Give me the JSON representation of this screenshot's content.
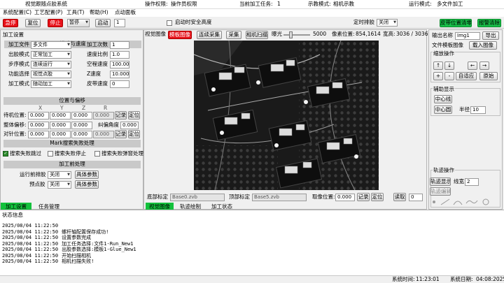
{
  "title": "视觉跟随点胶系统",
  "header_info": [
    {
      "label": "操作权限:",
      "value": "操作员权限"
    },
    {
      "label": "当前加工任务:",
      "value": "1"
    },
    {
      "label": "示教模式:",
      "value": "相机示教"
    },
    {
      "label": "运行模式:",
      "value": "多文件加工"
    }
  ],
  "menu": [
    "系统配置(C)",
    "工艺配置(P)",
    "工具(T)",
    "帮助(H)",
    "点动面板"
  ],
  "toolbar": {
    "emergency": "急停",
    "reset": "复位",
    "stop": "停止",
    "pause": "暂停",
    "start": "启动",
    "count": "1",
    "safe_height": "启动时安全高度",
    "timed_clear": "定时排胶",
    "timed_clear_value": "关闭",
    "back_to_pickup": "皮带位置清零",
    "alarm_clear": "报警清除"
  },
  "left": {
    "title": "加工设置",
    "mode_section": "模式与速度",
    "rows": [
      {
        "l1": "加工文件",
        "v1": "多文件",
        "l2": "加工次数",
        "v2": "1"
      },
      {
        "l1": "出胶模式",
        "v1": "正常加工",
        "l2": "速度比例",
        "v2": "1.0"
      },
      {
        "l1": "步序模式",
        "v1": "连续运行",
        "l2": "空程速度",
        "v2": "100.000"
      },
      {
        "l1": "功能选择",
        "v1": "视觉点胶",
        "l2": "Z速度",
        "v2": "10.000"
      },
      {
        "l1": "加工模式",
        "v1": "随动加工",
        "l2": "皮带速度",
        "v2": "0"
      }
    ],
    "pos_section": "位置与偏移",
    "axes": [
      "X",
      "Y",
      "Z",
      "R"
    ],
    "pos_rows": [
      {
        "label": "待机位置:",
        "vals": [
          "0.000",
          "0.000",
          "0.000",
          "0.000"
        ],
        "b1": "记录",
        "b2": "定位"
      },
      {
        "label": "整体偏移:",
        "vals": [
          "0.000",
          "0.000",
          "0.000"
        ],
        "extra_label": "纠偏角度",
        "extra_val": "0.000"
      },
      {
        "label": "对针位置:",
        "vals": [
          "0.000",
          "0.000",
          "0.000",
          "0.000"
        ],
        "b1": "记录",
        "b2": "定位"
      }
    ],
    "mark_section": "Mark搜索失败处理",
    "mark_opts": [
      "搜索失败跳过",
      "搜索失败停止",
      "搜索失败弹窗处理"
    ],
    "pre_section": "加工前处理",
    "pre_rows": [
      {
        "label": "运行前排胶",
        "value": "关闭",
        "btn": "具体参数"
      },
      {
        "label": "预点胶",
        "value": "关闭",
        "btn": "具体参数"
      }
    ],
    "tabs": [
      "加工设置",
      "任务管理"
    ]
  },
  "vision": {
    "tab_label": "视觉图像",
    "template_btn": "模板图像",
    "continuous": "连续采集",
    "capture": "采集",
    "scan": "相机扫描",
    "exposure_label": "曝光",
    "exposure": "5000",
    "pixel_label": "像素位置:",
    "pixel": "854,1614",
    "width_label": "宽高:",
    "width": "3036 / 3036",
    "bottom_label": "底部标定",
    "bottom_val": "Base0.zvb",
    "top_label": "顶部标定",
    "top_val": "Base5.zvb",
    "take_pos_label": "取像位置:",
    "take_pos": "0.000",
    "record": "记录",
    "locate": "定位",
    "read": "读取",
    "read_val": "0",
    "tabs": [
      "视觉图像",
      "轨迹绘制",
      "加工状态"
    ]
  },
  "right": {
    "name_label": "输出名称",
    "name_val": "Img1",
    "export": "导出",
    "template_label": "文件模板图像",
    "load": "载入图像",
    "zoom_title": "缩放操作",
    "arrows": [
      "↑",
      "↓",
      "←",
      "→"
    ],
    "zoom": [
      "+",
      "-"
    ],
    "fit": "自适应",
    "original": "原始",
    "aux_title": "辅助显示",
    "center_line": "中心线",
    "center_circle": "中心圆",
    "radius_label": "半径",
    "radius": "10",
    "track_title": "轨迹操作",
    "track_show": "轨迹显示",
    "line_width_label": "线宽",
    "line_width": "2",
    "track_edit": "轨迹编辑"
  },
  "status": {
    "title": "状态信息",
    "logs": [
      {
        "t": "2025/08/04 11:22:50",
        "m": ""
      },
      {
        "t": "2025/08/04 11:22:50",
        "m": "螺杆轴配置保存成功!"
      },
      {
        "t": "2025/08/04 11:22:50",
        "m": "设置参数完成"
      },
      {
        "t": "2025/08/04 11:22:50",
        "m": "加工任务选择:文件1-Run_New1"
      },
      {
        "t": "2025/08/04 11:22:50",
        "m": "出胶参数选择:模板1-Glue_New1"
      },
      {
        "t": "2025/08/04 11:22:50",
        "m": "开始扫描相机"
      },
      {
        "t": "2025/08/04 11:22:50",
        "m": "相机扫描失败!"
      }
    ],
    "sys_time_label": "系统时间:",
    "sys_time": "11:23:01",
    "sys_date_label": "系统日期:",
    "sys_date": "04:08:2025"
  },
  "colors": {
    "accent_red": "#e8111a",
    "accent_green": "#18c04a"
  }
}
